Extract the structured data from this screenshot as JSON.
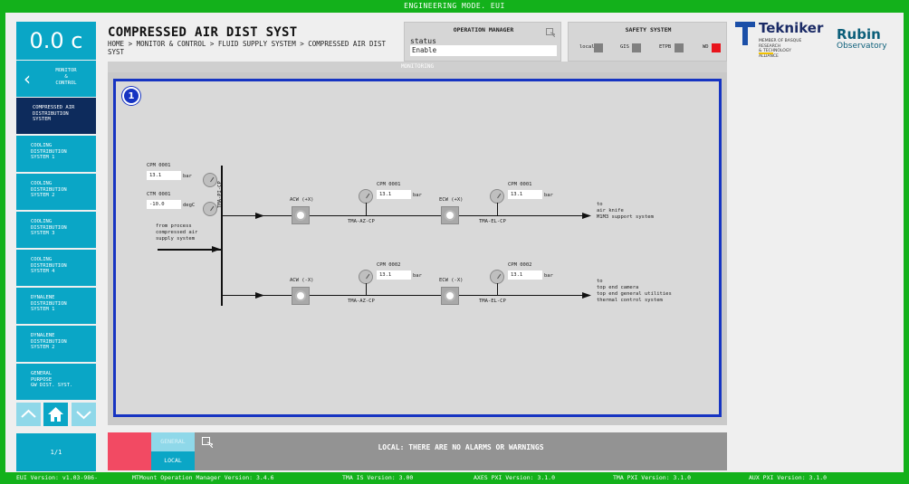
{
  "topbar": {
    "title": "ENGINEERING MODE. EUI"
  },
  "sidebar": {
    "temperature": "0.0 c",
    "back_label": "MONITOR\n&\nCONTROL",
    "items": [
      {
        "label": "COMPRESSED AIR\nDISTRIBUTION\nSYSTEM",
        "active": true
      },
      {
        "label": "COOLING\nDISTRIBUTION\nSYSTEM 1"
      },
      {
        "label": "COOLING\nDISTRIBUTION\nSYSTEM 2"
      },
      {
        "label": "COOLING\nDISTRIBUTION\nSYSTEM 3"
      },
      {
        "label": "COOLING\nDISTRIBUTION\nSYSTEM 4"
      },
      {
        "label": "DYNALENE\nDISTRIBUTION\nSYSTEM 1"
      },
      {
        "label": "DYNALENE\nDISTRIBUTION\nSYSTEM 2"
      },
      {
        "label": "GENERAL\nPURPOSE\nGW DIST. SYST."
      }
    ],
    "pager": "1/1"
  },
  "header": {
    "title": "COMPRESSED AIR DIST SYST",
    "breadcrumb": "HOME > MONITOR & CONTROL > FLUID SUPPLY SYSTEM > COMPRESSED AIR DIST SYST"
  },
  "operation_manager": {
    "title": "OPERATION MANAGER",
    "status_label": "status",
    "status_value": "Enable"
  },
  "safety_system": {
    "title": "SAFETY SYSTEM",
    "flags": [
      {
        "label": "local",
        "color": "#808080"
      },
      {
        "label": "GIS",
        "color": "#808080"
      },
      {
        "label": "ETPB",
        "color": "#808080"
      },
      {
        "label": "WD",
        "color": "#e8141c"
      }
    ]
  },
  "logos": {
    "tekniker": "Tekniker",
    "tekniker_sub": "MEMBER OF BASQUE RESEARCH\n& TECHNOLOGY ALLIANCE",
    "rubin": "Rubin",
    "rubin_sub": "Observatory"
  },
  "monitoring": {
    "header": "MONITORING",
    "badge": "1",
    "left_pressure_label": "CPM 0001",
    "left_pressure_value": "13.1",
    "left_pressure_unit": "bar",
    "left_temp_label": "CTM 0001",
    "left_temp_value": "-10.0",
    "left_temp_unit": "degC",
    "vertical_tag": "TMA-PI-CP",
    "source_text": "from process\ncompressed air\nsupply system",
    "top_line": {
      "valve1": "ACW (+X)",
      "cpm1_label": "CPM 0001",
      "cpm1_value": "13.1",
      "cpm1_unit": "bar",
      "tag1": "TMA-AZ-CP",
      "valve2": "ECW (+X)",
      "cpm2_label": "CPM 0001",
      "cpm2_value": "13.1",
      "cpm2_unit": "bar",
      "tag2": "TMA-EL-CP",
      "dest": "to\n air knife\n M1M3 support system"
    },
    "bottom_line": {
      "valve1": "ACW (-X)",
      "cpm1_label": "CPM 0002",
      "cpm1_value": "13.1",
      "cpm1_unit": "bar",
      "tag1": "TMA-AZ-CP",
      "valve2": "ECW (-X)",
      "cpm2_label": "CPM 0002",
      "cpm2_value": "13.1",
      "cpm2_unit": "bar",
      "tag2": "TMA-EL-CP",
      "dest": "to\n top end camera\n top end general utilities\n thermal control system"
    }
  },
  "alarms": {
    "general_tab": "GENERAL",
    "local_tab": "LOCAL",
    "message": "LOCAL: THERE ARE NO ALARMS OR WARNINGS"
  },
  "versions": {
    "eui": "EUI Version: v1.03-986-",
    "mtmount": "MTMount Operation Manager Version: 3.4.6",
    "tma_is": "TMA IS Version: 3.00",
    "axes": "AXES PXI Version: 3.1.0",
    "tma_pxi": "TMA PXI Version: 3.1.0",
    "aux": "AUX PXI Version: 3.1.0"
  }
}
